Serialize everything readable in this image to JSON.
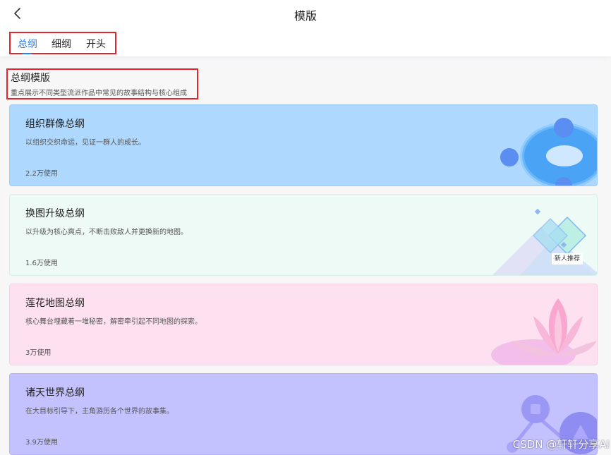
{
  "header": {
    "title": "模版",
    "back_icon": "back-chevron-icon"
  },
  "tabs": [
    {
      "label": "总纲",
      "active": true
    },
    {
      "label": "细纲",
      "active": false
    },
    {
      "label": "开头",
      "active": false
    }
  ],
  "section": {
    "title": "总纲模版",
    "description": "重点展示不同类型流派作品中常见的故事结构与核心组成"
  },
  "cards": [
    {
      "title": "组织群像总纲",
      "description": "以组织交织命运，见证一群人的成长。",
      "usage": "2.2万使用",
      "color": "#aed8fe",
      "art": "lifebuoy-icon"
    },
    {
      "title": "换图升级总纲",
      "description": "以升级为核心爽点，不断击败敌人并更换新的地图。",
      "usage": "1.6万使用",
      "color": "#eefaf6",
      "art": "diamond-map-icon",
      "badge": "新人推荐"
    },
    {
      "title": "莲花地图总纲",
      "description": "核心舞台埋藏着一堆秘密，解密牵引起不同地图的探索。",
      "usage": "3万使用",
      "color": "#fee1f0",
      "art": "lotus-icon"
    },
    {
      "title": "诸天世界总纲",
      "description": "在大目标引导下，主角游历各个世界的故事集。",
      "usage": "3.9万使用",
      "color": "#c4c2fe",
      "art": "planet-network-icon"
    }
  ],
  "watermark": "CSDN @轩轩分享AI",
  "accent": "#2f7dff",
  "highlight_border": "#e5242b"
}
